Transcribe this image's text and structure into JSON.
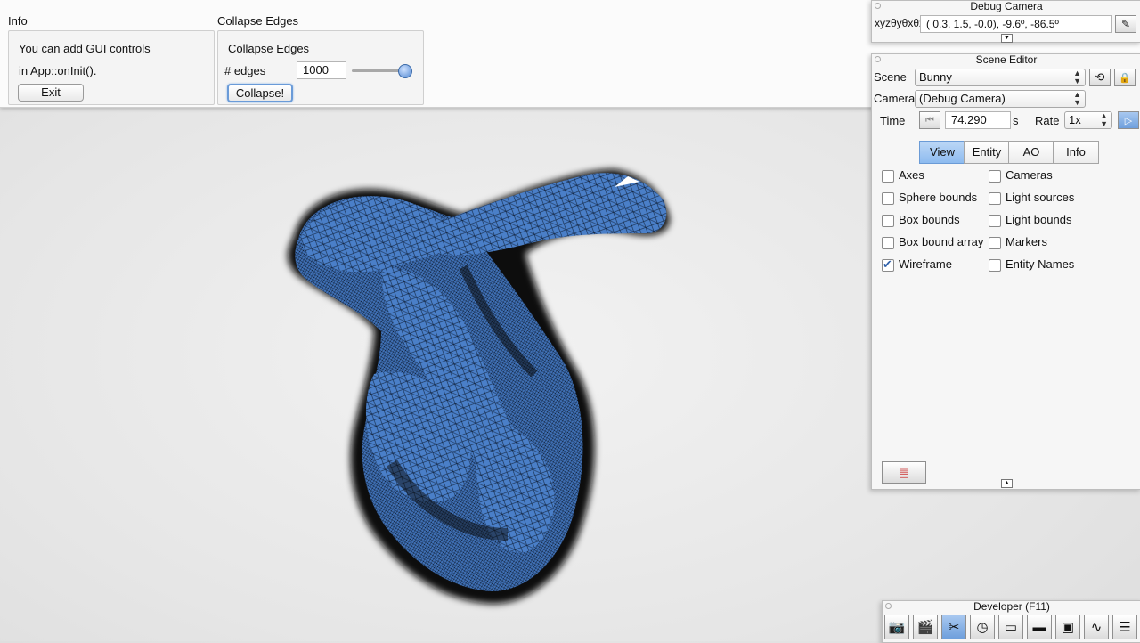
{
  "info_panel": {
    "title": "Info",
    "line1": "You can add GUI controls",
    "line2": "in App::onInit().",
    "exit_label": "Exit"
  },
  "collapse_panel": {
    "title": "Collapse Edges",
    "inner_title": "Collapse Edges",
    "edges_label": "# edges",
    "edges_value": "1000",
    "slider_fraction": 1.0,
    "collapse_label": "Collapse!"
  },
  "debug_camera": {
    "title": "Debug Camera",
    "xyz_label": "xyzθyθxθz",
    "coords": "(  0.3,   1.5,  -0.0),  -9.6º, -86.5º"
  },
  "scene_editor": {
    "title": "Scene Editor",
    "scene_label": "Scene",
    "scene_value": "Bunny",
    "camera_label": "Camera",
    "camera_value": "(Debug Camera)",
    "time_label": "Time",
    "time_value": "74.290",
    "time_unit": "s",
    "rate_label": "Rate",
    "rate_value": "1x",
    "tabs": [
      "View",
      "Entity",
      "AO",
      "Info"
    ],
    "active_tab": "View",
    "checkboxes_left": [
      {
        "label": "Axes",
        "checked": false
      },
      {
        "label": "Sphere bounds",
        "checked": false
      },
      {
        "label": "Box bounds",
        "checked": false
      },
      {
        "label": "Box bound array",
        "checked": false
      },
      {
        "label": "Wireframe",
        "checked": true
      }
    ],
    "checkboxes_right": [
      {
        "label": "Cameras",
        "checked": false
      },
      {
        "label": "Light sources",
        "checked": false
      },
      {
        "label": "Light bounds",
        "checked": false
      },
      {
        "label": "Markers",
        "checked": false
      },
      {
        "label": "Entity Names",
        "checked": false
      }
    ]
  },
  "developer": {
    "title": "Developer (F11)",
    "tools": [
      "camera-icon",
      "film-clapper-icon",
      "wrench-scissors-icon",
      "clock-icon",
      "note-icon",
      "terminal-icon",
      "windows-icon",
      "waveform-icon",
      "document-icon"
    ]
  },
  "colors": {
    "mesh_blue": "#4a7fc8",
    "accent": "#8dbbef"
  }
}
